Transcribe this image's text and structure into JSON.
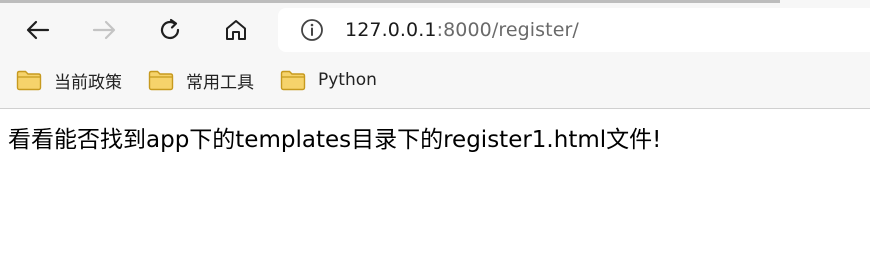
{
  "toolbar": {
    "back_icon": "arrow-left-icon",
    "forward_icon": "arrow-right-icon",
    "refresh_icon": "refresh-icon",
    "home_icon": "home-icon"
  },
  "address_bar": {
    "info_icon": "info-icon",
    "url_host": "127.0.0.1",
    "url_rest": ":8000/register/"
  },
  "bookmarks": [
    {
      "label": "当前政策",
      "icon": "folder-icon"
    },
    {
      "label": "常用工具",
      "icon": "folder-icon"
    },
    {
      "label": "Python",
      "icon": "folder-icon"
    }
  ],
  "page": {
    "body_text": "看看能否找到app下的templates目录下的register1.html文件!"
  },
  "colors": {
    "toolbar_bg": "#f7f7f7",
    "folder_fill": "#f6d36b",
    "folder_stroke": "#c79a1f",
    "url_host": "#1b1b1b",
    "url_rest": "#6a6a6a"
  }
}
